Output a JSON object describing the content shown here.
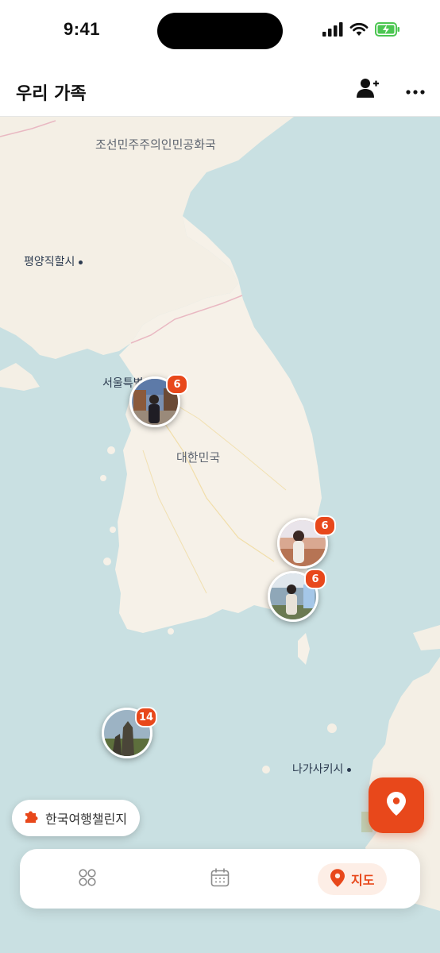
{
  "status_bar": {
    "time": "9:41"
  },
  "header": {
    "title": "우리 가족",
    "add_member_icon": "person-add-icon",
    "more_icon": "more-horizontal-icon"
  },
  "map": {
    "labels": {
      "north_korea": "조선민주주의인민공화국",
      "pyongyang": "평양직할시",
      "seoul": "서울특별시",
      "south_korea": "대한민국",
      "nagasaki": "나가사키시"
    },
    "clusters": [
      {
        "region": "seoul",
        "count": "6"
      },
      {
        "region": "east-coast",
        "count": "6"
      },
      {
        "region": "busan",
        "count": "6"
      },
      {
        "region": "jeju",
        "count": "14"
      }
    ]
  },
  "challenge_button": {
    "label": "한국여행챌린지",
    "icon": "puzzle-icon"
  },
  "location_fab": {
    "icon": "location-pin-icon"
  },
  "tab_bar": {
    "tabs": [
      {
        "icon": "grid-icon",
        "label": ""
      },
      {
        "icon": "calendar-icon",
        "label": ""
      },
      {
        "icon": "location-pin-icon",
        "label": "지도"
      }
    ]
  },
  "colors": {
    "accent": "#e8481b",
    "sea": "#c9e0e2",
    "land": "#f6f1e8"
  }
}
